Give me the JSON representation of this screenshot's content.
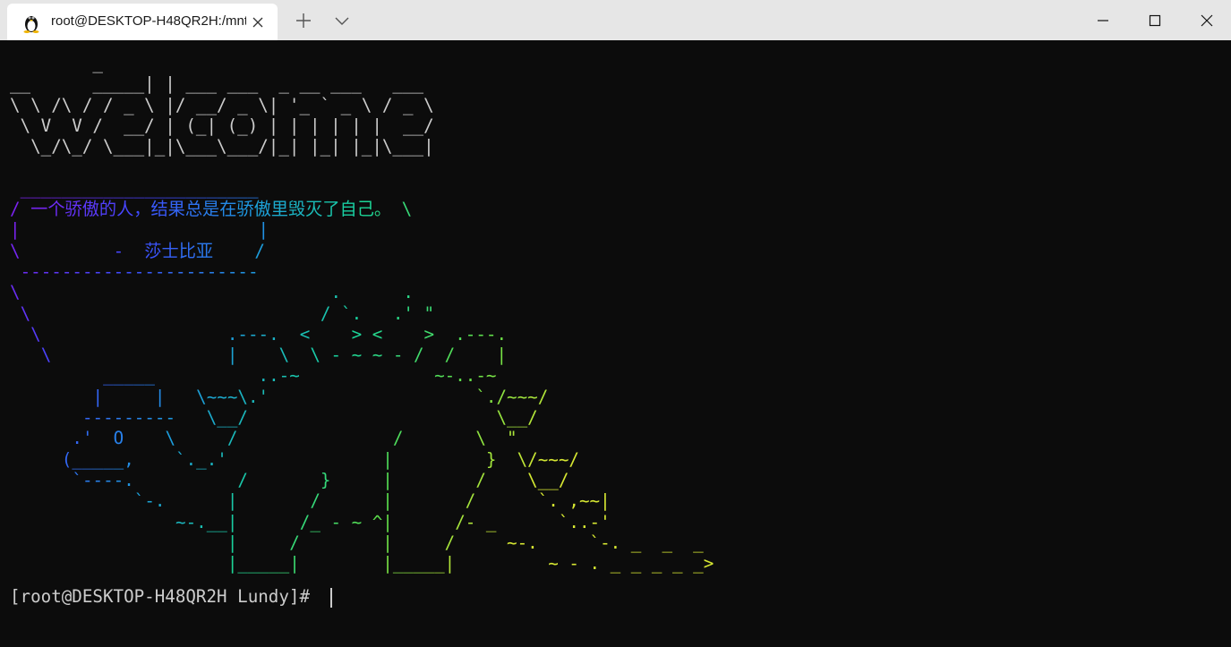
{
  "window": {
    "tab_title": "root@DESKTOP-H48QR2H:/mnt",
    "tab_icon": "linux-penguin-icon"
  },
  "terminal": {
    "art_lines": [
      "        _",
      "__      _____| | ___ ___  _ __ ___   ___",
      "\\ \\ /\\ / / _ \\ |/ __/ _ \\| '_ ` _ \\ / _ \\",
      " \\ V  V /  __/ | (_| (_) | | | | | |  __/",
      "  \\_/\\_/ \\___|_|\\___\\___/|_| |_| |_|\\___|",
      "",
      " _______________________",
      "/ 一个骄傲的人，结果总是在骄傲里毁灭了自己。 \\",
      "|                       |",
      "\\         -  莎士比亚    /",
      " -----------------------",
      "\\                              .      .",
      " \\                            / `.   .' \"",
      "  \\                  .---.  <    > <    >  .---.",
      "   \\                 |    \\  \\ - ~ ~ - /  /    |",
      "         _____          ..-~             ~-..-~",
      "        |     |   \\~~~\\.'                    `./~~~/",
      "       ---------   \\__/                        \\__/",
      "      .'  O    \\     /               /       \\  \"",
      "     (_____,    `._.'               |         }  \\/~~~/",
      "      `----.          /       }     |        /    \\__/",
      "            `-.      |       /      |       /      `. ,~~|",
      "                ~-.__|      /_ - ~ ^|      /- _      `..-'",
      "                     |     /        |     /     ~-.     `-. _  _  _",
      "                     |_____|        |_____|         ~ - . _ _ _ _ _>"
    ],
    "prompt": "[root@DESKTOP-H48QR2H Lundy]#"
  },
  "colors": {
    "background": "#0c0c0c",
    "titlebar": "#e6e6e6",
    "text": "#cccccc",
    "gradient": [
      "#7a22ee",
      "#3f4bff",
      "#1d9ae0",
      "#19d49a",
      "#5ee04a",
      "#d7e832"
    ]
  }
}
